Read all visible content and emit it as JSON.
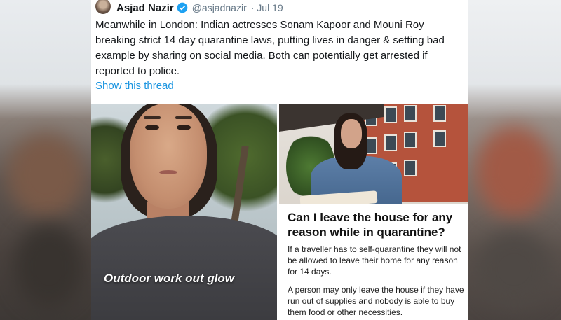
{
  "tweet": {
    "author_name": "Asjad Nazir",
    "handle": "@asjadnazir",
    "date": "· Jul 19",
    "text": "Meanwhile in London: Indian actresses Sonam Kapoor and Mouni Roy breaking strict 14 day quarantine laws, putting lives in danger & setting bad example by sharing on social media. Both can potentially get arrested if reported to police.",
    "thread_link": "Show this thread"
  },
  "media": {
    "left_caption": "Outdoor work out glow",
    "article_title": "Can I leave the house for any reason while in quarantine?",
    "article_p1": "If a traveller has to self-quarantine they will not be allowed to leave their home for any reason for 14 days.",
    "article_p2": "A person may only leave the house if they have run out of supplies and nobody is able to buy them food or other necessities."
  },
  "colors": {
    "link": "#1b95e0",
    "verified": "#1da1f2",
    "text": "#14171a",
    "secondary": "#657786"
  },
  "icons": [
    "verified-badge-icon",
    "avatar"
  ]
}
